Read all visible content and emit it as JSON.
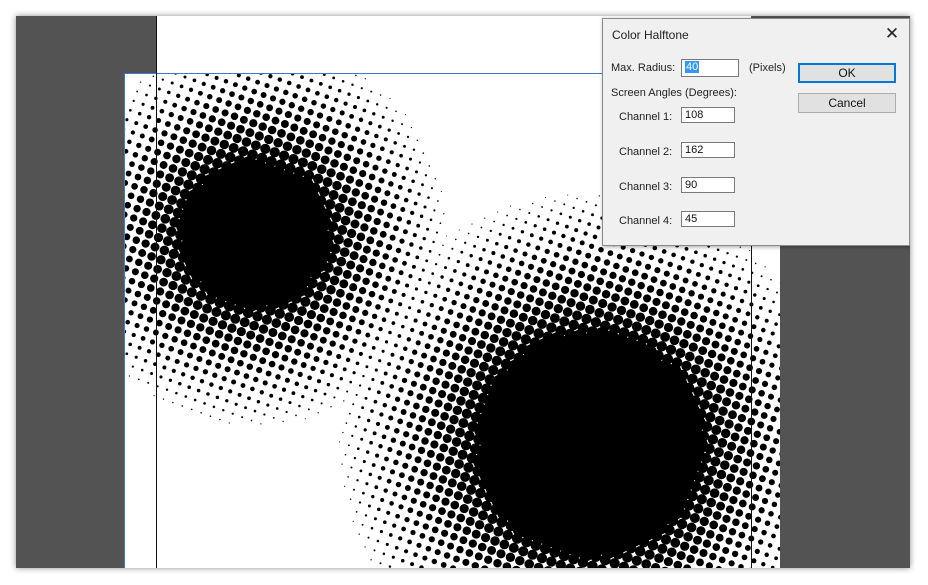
{
  "dialog": {
    "title": "Color Halftone",
    "close_glyph": "✕",
    "max_radius_label": "Max. Radius:",
    "max_radius_value": "40",
    "max_radius_unit": "(Pixels)",
    "screen_angles_label": "Screen Angles (Degrees):",
    "channels": [
      {
        "label": "Channel 1:",
        "value": "108"
      },
      {
        "label": "Channel 2:",
        "value": "162"
      },
      {
        "label": "Channel 3:",
        "value": "90"
      },
      {
        "label": "Channel 4:",
        "value": "45"
      }
    ],
    "ok_label": "OK",
    "cancel_label": "Cancel"
  },
  "colors": {
    "workspace": "#535353",
    "canvas": "#ffffff",
    "dots": "#000000",
    "selection_edge": "#3a7bd5",
    "focus": "#0078d7"
  },
  "icons": {
    "close": "close-icon"
  }
}
